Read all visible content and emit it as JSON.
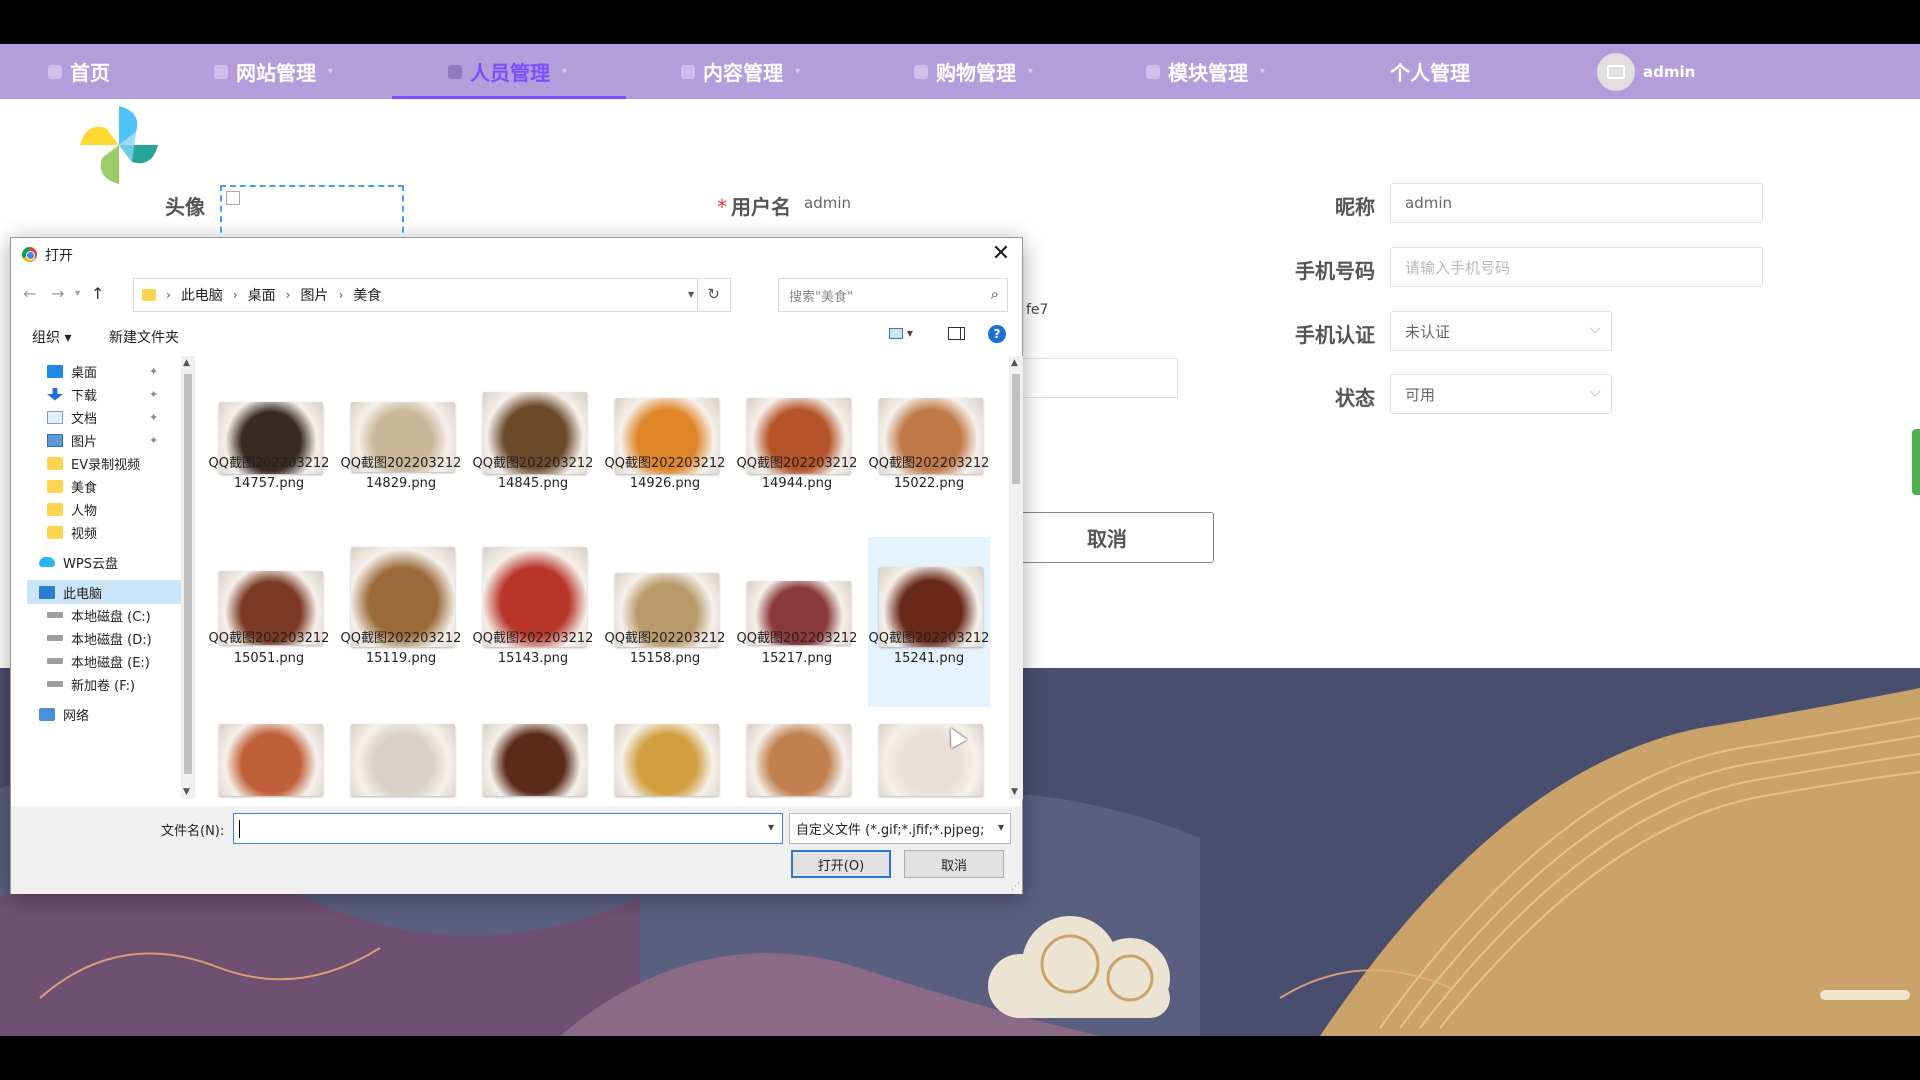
{
  "nav": {
    "items": [
      {
        "label": "首页",
        "icon": "home-icon"
      },
      {
        "label": "网站管理",
        "icon": "monitor-icon"
      },
      {
        "label": "人员管理",
        "icon": "user-icon",
        "active": true
      },
      {
        "label": "内容管理",
        "icon": "content-icon"
      },
      {
        "label": "购物管理",
        "icon": "bag-icon"
      },
      {
        "label": "模块管理",
        "icon": "module-icon"
      },
      {
        "label": "个人管理",
        "icon": ""
      }
    ],
    "user": "admin",
    "bg_color": "#b39ddb",
    "active_color": "#7c4dff"
  },
  "form": {
    "avatar_label": "头像",
    "username_label": "用户名",
    "username_value": "admin",
    "nickname_label": "昵称",
    "nickname_value": "admin",
    "phone_label": "手机号码",
    "phone_placeholder": "请输入手机号码",
    "phone_verify_label": "手机认证",
    "phone_verify_value": "未认证",
    "status_label": "状态",
    "status_value": "可用",
    "partial_text": "fe7",
    "cancel_label": "取消"
  },
  "dialog": {
    "title": "打开",
    "breadcrumb": [
      "此电脑",
      "桌面",
      "图片",
      "美食"
    ],
    "search_placeholder": "搜索\"美食\"",
    "toolbar": {
      "organize": "组织 ▾",
      "new_folder": "新建文件夹",
      "help": "?"
    },
    "tree": [
      {
        "label": "桌面",
        "icon": "desktop-icon",
        "pinned": true
      },
      {
        "label": "下载",
        "icon": "download-icon",
        "pinned": true
      },
      {
        "label": "文档",
        "icon": "document-icon",
        "pinned": true
      },
      {
        "label": "图片",
        "icon": "pictures-icon",
        "pinned": true
      },
      {
        "label": "EV录制视频",
        "icon": "folder-icon"
      },
      {
        "label": "美食",
        "icon": "folder-icon"
      },
      {
        "label": "人物",
        "icon": "folder-icon"
      },
      {
        "label": "视频",
        "icon": "folder-icon"
      },
      {
        "label": "WPS云盘",
        "icon": "cloud-icon"
      },
      {
        "label": "此电脑",
        "icon": "computer-icon",
        "selected": true
      },
      {
        "label": "本地磁盘 (C:)",
        "icon": "disk-icon"
      },
      {
        "label": "本地磁盘 (D:)",
        "icon": "disk-icon"
      },
      {
        "label": "本地磁盘 (E:)",
        "icon": "disk-icon"
      },
      {
        "label": "新加卷 (F:)",
        "icon": "disk-icon"
      },
      {
        "label": "网络",
        "icon": "network-icon"
      }
    ],
    "files": [
      {
        "name": "QQ截图20220321214757.png",
        "color": "#3a2a24"
      },
      {
        "name": "QQ截图20220321214829.png",
        "color": "#c9b89a"
      },
      {
        "name": "QQ截图20220321214845.png",
        "color": "#6b4a2a"
      },
      {
        "name": "QQ截图20220321214926.png",
        "color": "#e0862a"
      },
      {
        "name": "QQ截图20220321214944.png",
        "color": "#b5542a"
      },
      {
        "name": "QQ截图20220321215022.png",
        "color": "#c07a4a"
      },
      {
        "name": "QQ截图20220321215051.png",
        "color": "#7a3a24"
      },
      {
        "name": "QQ截图20220321215119.png",
        "color": "#9a6a3a"
      },
      {
        "name": "QQ截图20220321215143.png",
        "color": "#b8352a"
      },
      {
        "name": "QQ截图20220321215158.png",
        "color": "#b89a6a"
      },
      {
        "name": "QQ截图20220321215217.png",
        "color": "#8a3a3a"
      },
      {
        "name": "QQ截图20220321215241.png",
        "color": "#6a2a1a",
        "selected": true
      },
      {
        "name": "",
        "color": "#c0603a"
      },
      {
        "name": "",
        "color": "#d8d2c8"
      },
      {
        "name": "",
        "color": "#5a2a1a"
      },
      {
        "name": "",
        "color": "#d0a040"
      },
      {
        "name": "",
        "color": "#c08050"
      },
      {
        "name": "",
        "color": "#e8e0d8"
      }
    ],
    "filename_label": "文件名(N):",
    "filename_value": "",
    "filetype_value": "自定义文件 (*.gif;*.jfif;*.pjpeg;",
    "open_label": "打开(O)",
    "cancel_label": "取消"
  }
}
